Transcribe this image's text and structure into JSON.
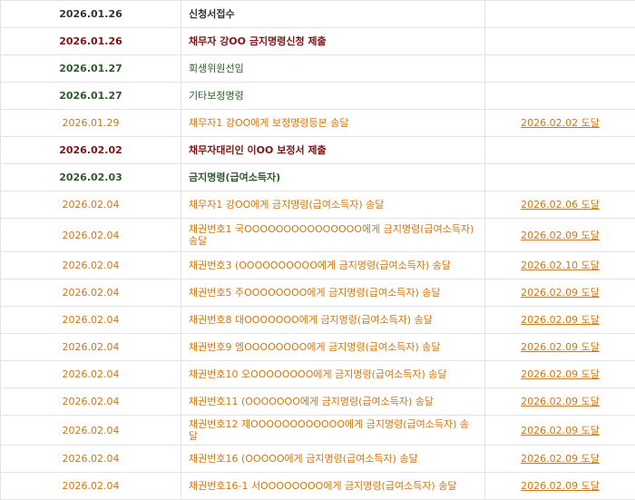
{
  "colors": {
    "dark": "#333333",
    "maroon": "#7b1616",
    "green": "#2f5b2a",
    "orange": "#d0770f"
  },
  "rows": [
    {
      "date": "2026.01.26",
      "event": "신청서접수",
      "result": ""
    },
    {
      "date": "2026.01.26",
      "event": "채무자 강OO 금지명령신청 제출",
      "result": ""
    },
    {
      "date": "2026.01.27",
      "event": "회생위원선임",
      "result": ""
    },
    {
      "date": "2026.01.27",
      "event": "기타보정명령",
      "result": ""
    },
    {
      "date": "2026.01.29",
      "event": "채무자1 강OO에게 보정명령등본 송달",
      "result": "2026.02.02 도달"
    },
    {
      "date": "2026.02.02",
      "event": "채무자대리인 이OO 보정서 제출",
      "result": ""
    },
    {
      "date": "2026.02.03",
      "event": "금지명령(급여소득자)",
      "result": ""
    },
    {
      "date": "2026.02.04",
      "event": "채무자1 강OO에게 금지명령(급여소득자) 송달",
      "result": "2026.02.06 도달"
    },
    {
      "date": "2026.02.04",
      "event": "채권번호1 국OOOOOOOOOOOOOOO에게 금지명령(급여소득자) 송달",
      "result": "2026.02.09 도달"
    },
    {
      "date": "2026.02.04",
      "event": "채권번호3 (OOOOOOOOOO에게 금지명령(급여소득자) 송달",
      "result": "2026.02.10 도달"
    },
    {
      "date": "2026.02.04",
      "event": "채권번호5 주OOOOOOOO에게 금지명령(급여소득자) 송달",
      "result": "2026.02.09 도달"
    },
    {
      "date": "2026.02.04",
      "event": "채권번호8 대OOOOOOO에게 금지명령(급여소득자) 송달",
      "result": "2026.02.09 도달"
    },
    {
      "date": "2026.02.04",
      "event": "채권번호9 엠OOOOOOOO에게 금지명령(급여소득자) 송달",
      "result": "2026.02.09 도달"
    },
    {
      "date": "2026.02.04",
      "event": "채권번호10 오OOOOOOOO에게 금지명령(급여소득자) 송달",
      "result": "2026.02.09 도달"
    },
    {
      "date": "2026.02.04",
      "event": "채권번호11 (OOOOOOO에게 금지명령(급여소득자) 송달",
      "result": "2026.02.09 도달"
    },
    {
      "date": "2026.02.04",
      "event": "채권번호12 제OOOOOOOOOOOO에게 금지명령(급여소득자) 송달",
      "result": "2026.02.09 도달"
    },
    {
      "date": "2026.02.04",
      "event": "채권번호16 (OOOOO에게 금지명령(급여소득자) 송달",
      "result": "2026.02.09 도달"
    },
    {
      "date": "2026.02.04",
      "event": "채권번호16-1 서OOOOOOOO에게 금지명령(급여소득자) 송달",
      "result": "2026.02.09 도달"
    }
  ]
}
